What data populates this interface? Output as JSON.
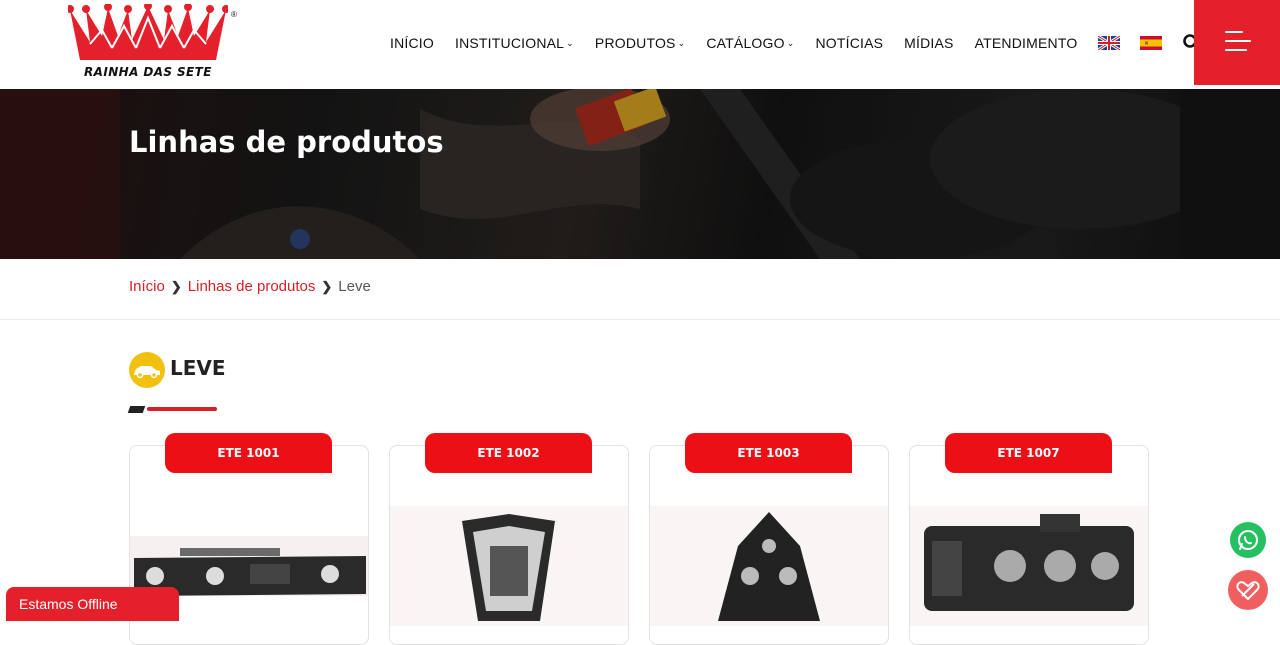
{
  "header": {
    "logo_text": "RAINHA DAS SETE",
    "logo_mark": "®",
    "nav": [
      {
        "label": "INÍCIO",
        "has_dropdown": false
      },
      {
        "label": "INSTITUCIONAL",
        "has_dropdown": true
      },
      {
        "label": "PRODUTOS",
        "has_dropdown": true
      },
      {
        "label": "CATÁLOGO",
        "has_dropdown": true
      },
      {
        "label": "NOTÍCIAS",
        "has_dropdown": false
      },
      {
        "label": "MÍDIAS",
        "has_dropdown": false
      },
      {
        "label": "ATENDIMENTO",
        "has_dropdown": false
      }
    ],
    "languages": [
      "uk-flag-icon",
      "spain-flag-icon"
    ],
    "accent_color": "#e4202b"
  },
  "hero": {
    "title": "Linhas de produtos"
  },
  "breadcrumb": {
    "items": [
      "Início",
      "Linhas de produtos"
    ],
    "current": "Leve"
  },
  "category": {
    "title": "LEVE",
    "icon": "car-icon",
    "icon_color": "#f2c10f"
  },
  "products": [
    {
      "code": "ETE 1001",
      "image": "bulb-holder-strip"
    },
    {
      "code": "ETE 1002",
      "image": "bulb-holder-triangle"
    },
    {
      "code": "ETE 1003",
      "image": "bulb-holder-triangle-dark"
    },
    {
      "code": "ETE 1007",
      "image": "bulb-holder-rect"
    }
  ],
  "chat": {
    "status": "Estamos Offline"
  }
}
